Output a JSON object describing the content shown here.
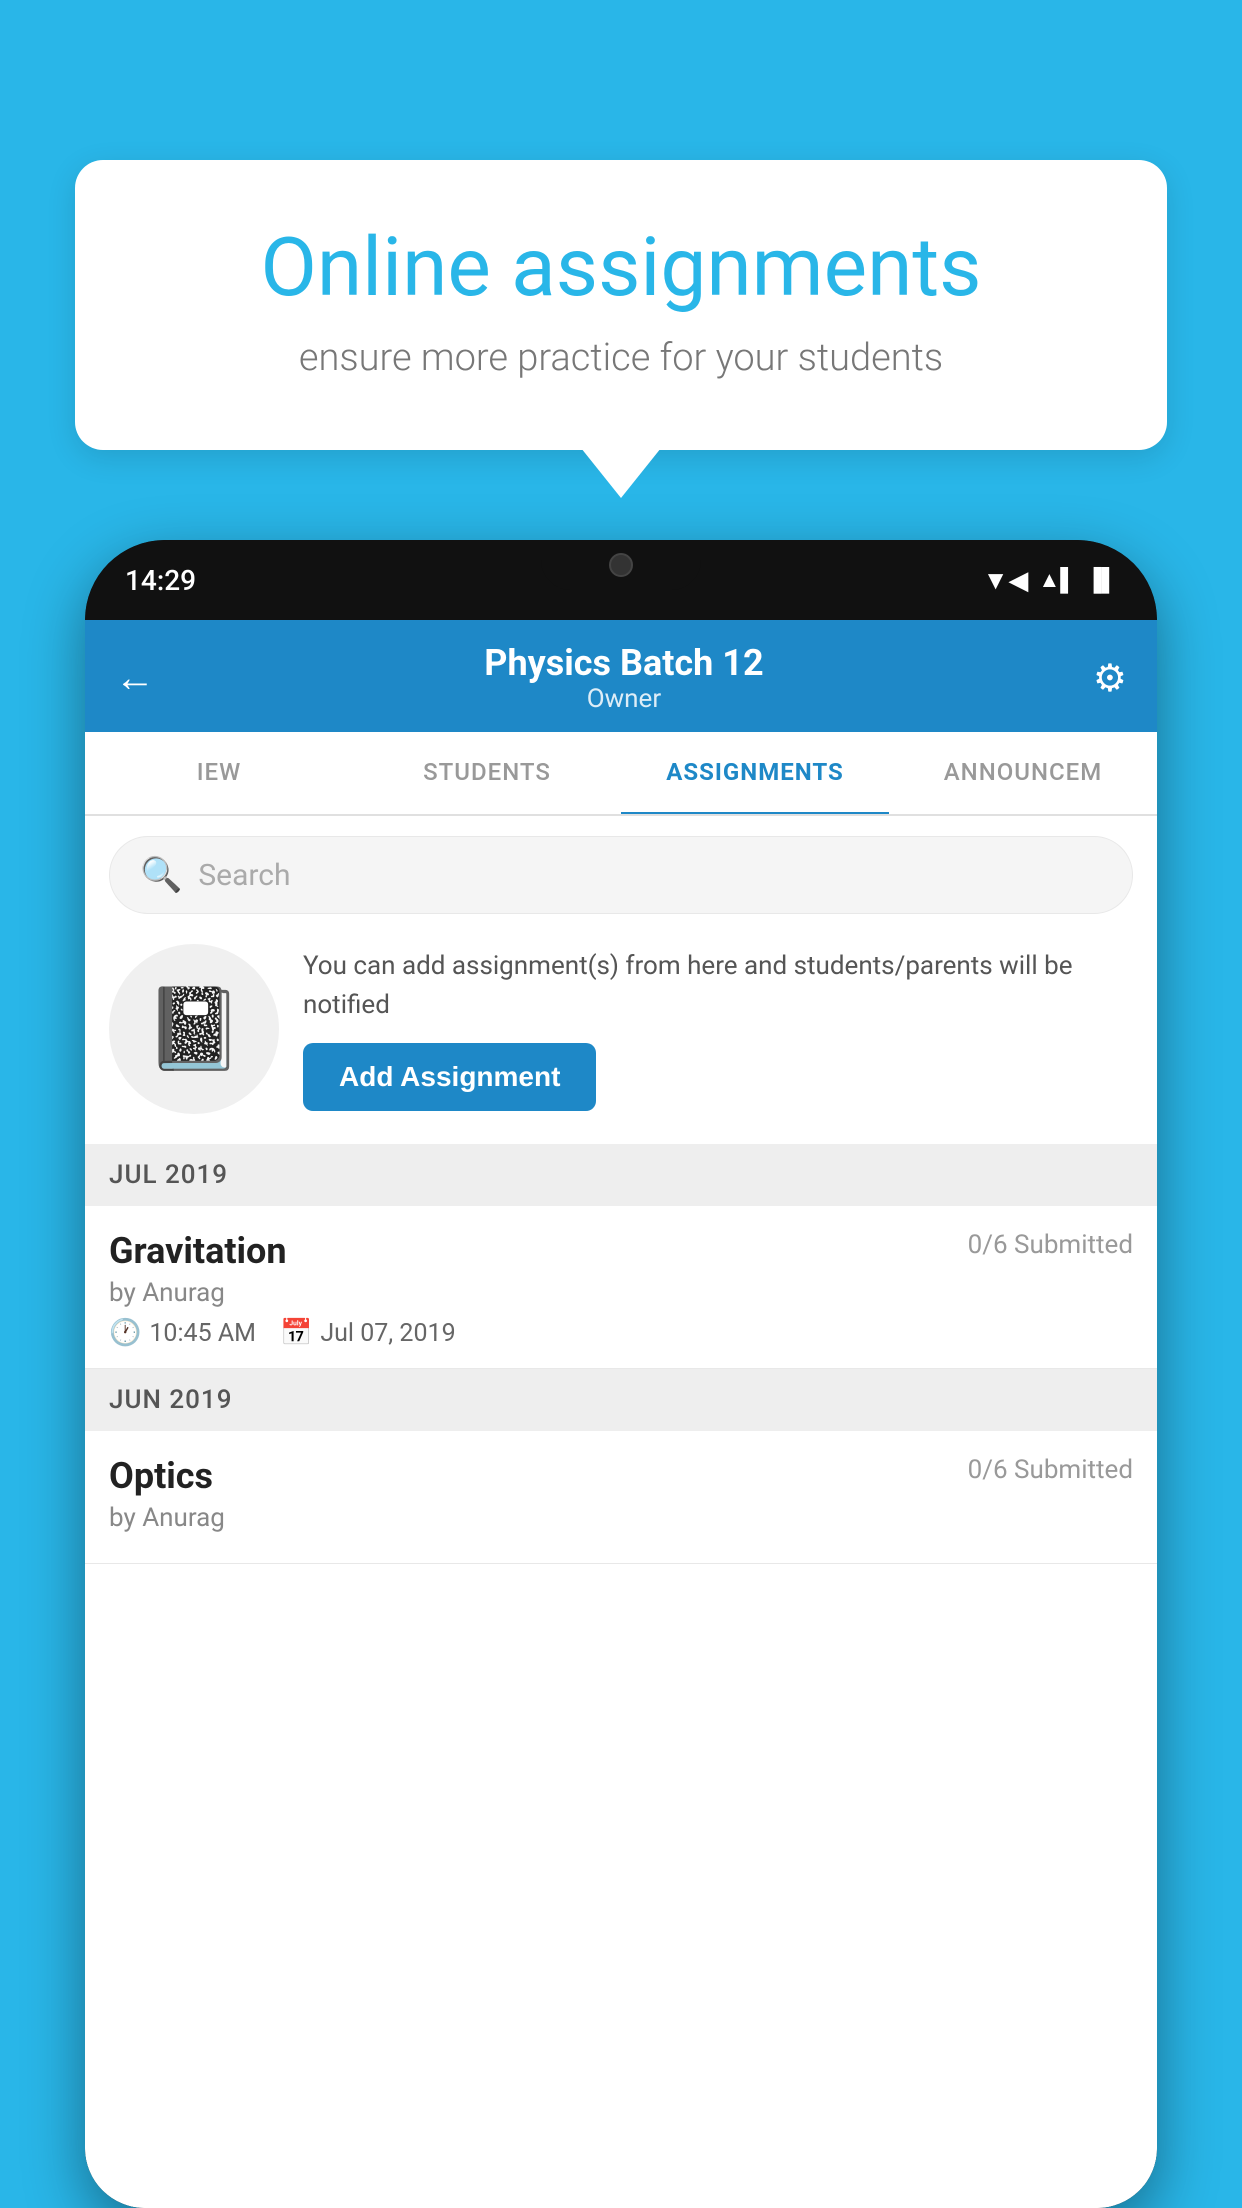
{
  "background_color": "#29b6e8",
  "speech_bubble": {
    "title": "Online assignments",
    "subtitle": "ensure more practice for your students"
  },
  "phone": {
    "status_bar": {
      "time": "14:29",
      "wifi": "▲",
      "signal": "▲",
      "battery": "▉"
    },
    "header": {
      "title": "Physics Batch 12",
      "subtitle": "Owner",
      "back_label": "←",
      "settings_label": "⚙"
    },
    "tabs": [
      {
        "label": "IEW",
        "active": false
      },
      {
        "label": "STUDENTS",
        "active": false
      },
      {
        "label": "ASSIGNMENTS",
        "active": true
      },
      {
        "label": "ANNOUNCEM",
        "active": false
      }
    ],
    "search": {
      "placeholder": "Search"
    },
    "promo": {
      "description": "You can add assignment(s) from here and students/parents will be notified",
      "button_label": "Add Assignment"
    },
    "sections": [
      {
        "month_label": "JUL 2019",
        "assignments": [
          {
            "name": "Gravitation",
            "status": "0/6 Submitted",
            "author": "by Anurag",
            "time": "10:45 AM",
            "date": "Jul 07, 2019"
          }
        ]
      },
      {
        "month_label": "JUN 2019",
        "assignments": [
          {
            "name": "Optics",
            "status": "0/6 Submitted",
            "author": "by Anurag",
            "time": "",
            "date": ""
          }
        ]
      }
    ]
  }
}
